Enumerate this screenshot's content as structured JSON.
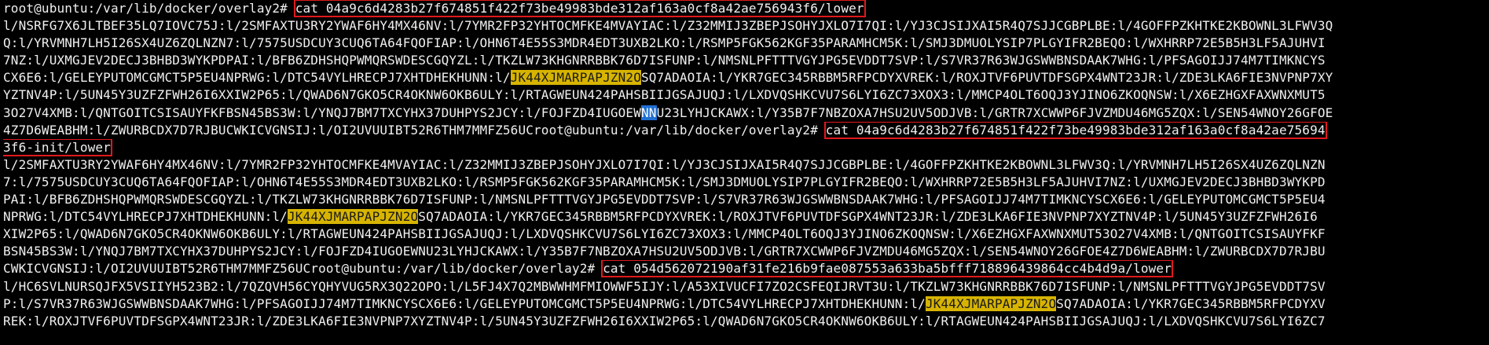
{
  "terminal": {
    "colors": {
      "background": "#000000",
      "foreground": "#f0f0f0",
      "command_box": "#e0191c",
      "search_highlight": "#d7b400",
      "selection": "#1f6fd1"
    },
    "lines": [
      [
        {
          "text": "root@ubuntu:/var/lib/docker/overlay2# ",
          "style": "prompt"
        },
        {
          "text": "cat 04a9c6d4283b27f674851f422f73be49983bde312af163a0cf8a42ae756943f6/lower",
          "style": "cmdbox"
        }
      ],
      [
        {
          "text": "l/NSRFG7X6JLTBEF35LQ7IOVC75J:l/2SMFAXTU3RY2YWAF6HY4MX46NV:l/7YMR2FP32YHTOCMFKE4MVAYIAC:l/Z32MMIJ3ZBEPJSOHYJXLO7I7QI:l/YJ3CJSIJXAI5R4Q7SJJCGBPLBE:l/4GOFFPZKHTKE2KBOWNL3LFWV3Q",
          "style": "plain"
        }
      ],
      [
        {
          "text": "Q:l/YRVMNH7LH5I26SX4UZ6ZQLNZN7:l/7575USDCUY3CUQ6TA64FQOFIAP:l/OHN6T4E55S3MDR4EDT3UXB2LKO:l/RSMP5FGK562KGF35PARAMHCM5K:l/SMJ3DMUOLYSIP7PLGYIFR2BEQO:l/WXHRRP72E5B5H3LF5AJUHVI",
          "style": "plain"
        }
      ],
      [
        {
          "text": "7NZ:l/UXMGJEV2DECJ3BHBD3WYKPDPAI:l/BFB6ZDHSHQPWMQRSWDESCGQYZL:l/TKZLW73KHGNRRBBK76D7ISFUNP:l/NMSNLPFTTTVGYJPG5EVDDT7SVP:l/S7VR37R63WJGSWWBNSDAAK7WHG:l/PFSAGOIJJ74M7TIMKNCYS",
          "style": "plain"
        }
      ],
      [
        {
          "text": "CX6E6:l/GELEYPUTOMCGMCT5P5EU4NPRWG:l/DTC54VYLHRECPJ7XHTDHEKHUNN:l/",
          "style": "plain"
        },
        {
          "text": "JK44XJMARPAPJZN2O",
          "style": "highlight"
        },
        {
          "text": "SQ7ADAOIA:l/YKR7GEC345RBBM5RFPCDYXVREK:l/ROXJTVF6PUVTDFSGPX4WNT23JR:l/ZDE3LKA6FIE3NVPNP7XY",
          "style": "plain"
        }
      ],
      [
        {
          "text": "YZTNV4P:l/5UN45Y3UZFZFWH26I6XXIW2P65:l/QWAD6N7GKO5CR4OKNW6OKB6ULY:l/RTAGWEUN424PAHSBIIJGSAJUQJ:l/LXDVQSHKCVU7S6LYI6ZC73XOX3:l/MMCP4OLT6OQJ3YJINO6ZKOQNSW:l/X6EZHGXFAXWNXMUT5",
          "style": "plain"
        }
      ],
      [
        {
          "text": "3O27V4XMB:l/QNTGOITCSISAUYFKFBSN45BS3W:l/YNQJ7BM7TXCYHX37DUHPYS2JCY:l/FOJFZD4IUGOEW",
          "style": "plain"
        },
        {
          "text": "NN",
          "style": "selected"
        },
        {
          "text": "U23LYHJCKAWX:l/Y35B7F7NBZOXA7HSU2UV5ODJVB:l/GRTR7XCWWP6FJVZMDU46MG5ZQX:l/SEN54WNOY26GFOE",
          "style": "plain"
        }
      ],
      [
        {
          "text": "4Z7D6WEABHM:l/ZWURBCDX7D7RJBUCWKICVGNSIJ:l/OI2UVUUIBT52R6THM7MMFZ56UCroot@ubuntu:/var/lib/docker/overlay2# ",
          "style": "plain"
        },
        {
          "text": "cat 04a9c6d4283b27f674851f422f73be49983bde312af163a0cf8a42ae75694",
          "style": "cmdbox"
        }
      ],
      [
        {
          "text": "3f6-init/lower",
          "style": "cmdbox"
        }
      ],
      [
        {
          "text": "l/2SMFAXTU3RY2YWAF6HY4MX46NV:l/7YMR2FP32YHTOCMFKE4MVAYIAC:l/Z32MMIJ3ZBEPJSOHYJXLO7I7QI:l/YJ3CJSIJXAI5R4Q7SJJCGBPLBE:l/4GOFFPZKHTKE2KBOWNL3LFWV3Q:l/YRVMNH7LH5I26SX4UZ6ZQLNZN",
          "style": "plain"
        }
      ],
      [
        {
          "text": "7:l/7575USDCUY3CUQ6TA64FQOFIAP:l/OHN6T4E55S3MDR4EDT3UXB2LKO:l/RSMP5FGK562KGF35PARAMHCM5K:l/SMJ3DMUOLYSIP7PLGYIFR2BEQO:l/WXHRRP72E5B5H3LF5AJUHVI7NZ:l/UXMGJEV2DECJ3BHBD3WYKPD",
          "style": "plain"
        }
      ],
      [
        {
          "text": "PAI:l/BFB6ZDHSHQPWMQRSWDESCGQYZL:l/TKZLW73KHGNRRBBK76D7ISFUNP:l/NMSNLPFTTTVGYJPG5EVDDT7SVP:l/S7VR37R63WJGSWWBNSDAAK7WHG:l/PFSAGOIJJ74M7TIMKNCYSCX6E6:l/GELEYPUTOMCGMCT5P5EU4",
          "style": "plain"
        }
      ],
      [
        {
          "text": "NPRWG:l/DTC54VYLHRECPJ7XHTDHEKHUNN:l/",
          "style": "plain"
        },
        {
          "text": "JK44XJMARPAPJZN2O",
          "style": "highlight"
        },
        {
          "text": "SQ7ADAOIA:l/YKR7GEC345RBBM5RFPCDYXVREK:l/ROXJTVF6PUVTDFSGPX4WNT23JR:l/ZDE3LKA6FIE3NVPNP7XYZTNV4P:l/5UN45Y3UZFZFWH26I6",
          "style": "plain"
        }
      ],
      [
        {
          "text": "XIW2P65:l/QWAD6N7GKO5CR4OKNW6OKB6ULY:l/RTAGWEUN424PAHSBIIJGSAJUQJ:l/LXDVQSHKCVU7S6LYI6ZC73XOX3:l/MMCP4OLT6OQJ3YJINO6ZKOQNSW:l/X6EZHGXFAXWNXMUT53O27V4XMB:l/QNTGOITCSISAUYFKF",
          "style": "plain"
        }
      ],
      [
        {
          "text": "BSN45BS3W:l/YNQJ7BM7TXCYHX37DUHPYS2JCY:l/FOJFZD4IUGOEWNU23LYHJCKAWX:l/Y35B7F7NBZOXA7HSU2UV5ODJVB:l/GRTR7XCWWP6FJVZMDU46MG5ZQX:l/SEN54WNOY26GFOE4Z7D6WEABHM:l/ZWURBCDX7D7RJBU",
          "style": "plain"
        }
      ],
      [
        {
          "text": "CWKICVGNSIJ:l/OI2UVUUIBT52R6THM7MMFZ56UCroot@ubuntu:/var/lib/docker/overlay2# ",
          "style": "plain"
        },
        {
          "text": "cat 054d562072190af31fe216b9fae087553a633ba5bfff718896439864cc4b4d9a/lower",
          "style": "cmdbox"
        }
      ],
      [
        {
          "text": "l/HC6SVLNURSQJFX5VSIIYH523B2:l/7QZQVH56CYQHYVUG5RX3Q22OPO:l/L5FJ4X7Q2MBWWHMFMIOWWF5IJY:l/A53XIVUCFI7ZO2CSFEQIJRVT3U:l/TKZLW73KHGNRRBBK76D7ISFUNP:l/NMSNLPFTTTVGYJPG5EVDDT7SV",
          "style": "plain"
        }
      ],
      [
        {
          "text": "P:l/S7VR37R63WJGSWWBNSDAAK7WHG:l/PFSAGOIJJ74M7TIMKNCYSCX6E6:l/GELEYPUTOMCGMCT5P5EU4NPRWG:l/DTC54VYLHRECPJ7XHTDHEKHUNN:l/",
          "style": "plain"
        },
        {
          "text": "JK44XJMARPAPJZN2O",
          "style": "highlight"
        },
        {
          "text": "SQ7ADAOIA:l/YKR7GEC345RBBM5RFPCDYXV",
          "style": "plain"
        }
      ],
      [
        {
          "text": "REK:l/ROXJTVF6PUVTDFSGPX4WNT23JR:l/ZDE3LKA6FIE3NVPNP7XYZTNV4P:l/5UN45Y3UZFZFWH26I6XXIW2P65:l/QWAD6N7GKO5CR4OKNW6OKB6ULY:l/RTAGWEUN424PAHSBIIJGSAJUQJ:l/LXDVQSHKCVU7S6LYI6ZC7",
          "style": "plain"
        }
      ]
    ]
  }
}
